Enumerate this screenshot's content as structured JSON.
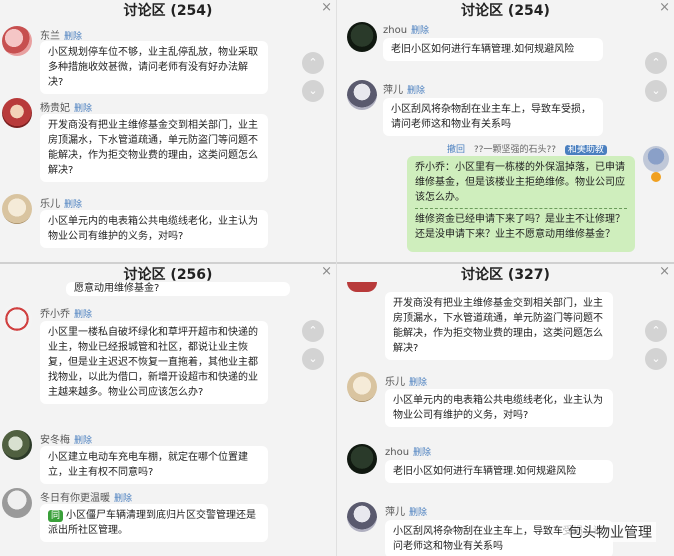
{
  "panels": {
    "top_left": {
      "title": "讨论区 (254)",
      "close": "×",
      "messages": [
        {
          "user": "东兰",
          "delete": "删除",
          "text": "小区规划停车位不够，业主乱停乱放，物业采取多种措施收效甚微，请问老师有没有好办法解决?"
        },
        {
          "user": "杨贵妃",
          "delete": "删除",
          "text": "开发商没有把业主维修基金交到相关部门，业主房顶漏水，下水管道疏通，单元防盗门等问题不能解决，作为拒交物业费的理由，这类问题怎么解决?"
        },
        {
          "user": "乐儿",
          "delete": "删除",
          "text": "小区单元内的电表箱公共电缆线老化，业主认为物业公司有维护的义务，对吗?"
        }
      ]
    },
    "top_right": {
      "title": "讨论区 (254)",
      "close": "×",
      "messages": [
        {
          "user": "zhou",
          "delete": "删除",
          "text": "老旧小区如何进行车辆管理.如何规避风险"
        },
        {
          "user": "萍儿",
          "delete": "删除",
          "text": "小区刮风将杂物刮在业主车上，导致车受损，请问老师这和物业有关系吗"
        }
      ],
      "withdraw": "撤回",
      "withdraw_hint": "??一颗坚强的石头??",
      "host_tag": "和美助教",
      "reply": {
        "user": "乔小乔",
        "text": "小区里有一栋楼的外保温掉落，已申请维修基金，但是该楼业主拒绝维修。物业公司应该怎么办。",
        "answer": "维修资金已经申请下来了吗？是业主不让修理？还是没申请下来？业主不愿意动用维修基金？"
      }
    },
    "bottom_left": {
      "title": "讨论区 (256)",
      "close": "×",
      "top_fragment": "愿意动用维修基金?",
      "messages": [
        {
          "user": "乔小乔",
          "delete": "删除",
          "text": "小区里一楼私自破坏绿化和草坪开超市和快递的业主，物业已经报城管和社区，都说让业主恢复，但是业主迟迟不恢复一直拖着，其他业主都找物业，以此为借口，新增开设超市和快递的业主越来越多。物业公司应该怎么办?"
        },
        {
          "user": "安冬梅",
          "delete": "删除",
          "text": "小区建立电动车充电车棚，就定在哪个位置建立，业主有权不同意吗?"
        },
        {
          "user": "冬日有你更温暖",
          "delete": "删除",
          "badge": "同",
          "text": "小区僵尸车辆清理到底归片区交警管理还是派出所社区管理。"
        }
      ]
    },
    "bottom_right": {
      "title": "讨论区 (327)",
      "close": "×",
      "messages": [
        {
          "user": "",
          "delete": "",
          "text": "开发商没有把业主维修基金交到相关部门，业主房顶漏水，下水管道疏通，单元防盗门等问题不能解决，作为拒交物业费的理由，这类问题怎么解决?"
        },
        {
          "user": "乐儿",
          "delete": "删除",
          "text": "小区单元内的电表箱公共电缆线老化，业主认为物业公司有维护的义务，对吗?"
        },
        {
          "user": "zhou",
          "delete": "删除",
          "text": "老旧小区如何进行车辆管理.如何规避风险"
        },
        {
          "user": "萍儿",
          "delete": "删除",
          "text": "小区刮风将杂物刮在业主车上，导致车受损，请问老师这和物业有关系吗"
        }
      ]
    }
  },
  "scroll": {
    "up": "⌃",
    "down": "⌄"
  },
  "watermark": "包头物业管理",
  "colors": {
    "bubble": "#ffffff",
    "reply_bubble": "#cfeebd",
    "link": "#4a7fbf",
    "background": "#f3f3f3"
  }
}
